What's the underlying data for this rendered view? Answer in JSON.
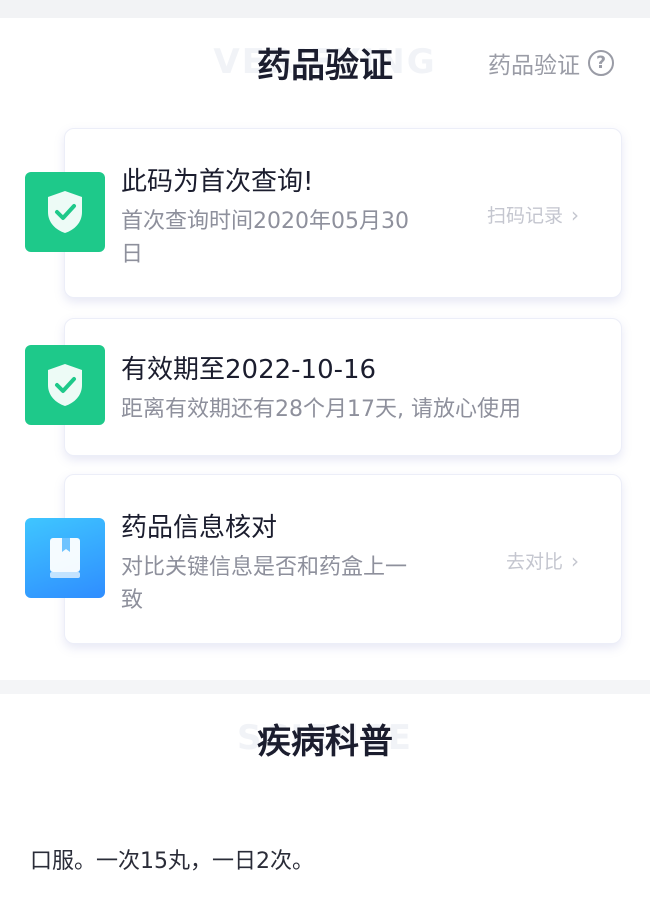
{
  "colors": {
    "accent_green": "#1ec98a",
    "accent_blue": "#2f8dff",
    "title_text": "#1b1d2e",
    "muted_text": "#8e909c"
  },
  "verification_section": {
    "watermark": "VERIFYING",
    "title": "药品验证",
    "help_label": "药品验证",
    "help_icon": "question-circle-icon"
  },
  "cards": [
    {
      "icon": "shield-check-icon",
      "title": "此码为首次查询!",
      "desc_line1": "首次查询时间2020年05月30",
      "desc_line2": "日",
      "link": "扫码记录"
    },
    {
      "icon": "shield-check-icon",
      "title": "有效期至2022-10-16",
      "desc_line1": "距离有效期还有28个月17天, 请放心使用"
    },
    {
      "icon": "book-icon",
      "title": "药品信息核对",
      "desc_line1": "对比关键信息是否和药盒上一",
      "desc_line2": "致",
      "link": "去对比"
    }
  ],
  "science_section": {
    "watermark": "SCIENCE",
    "title": "疾病科普"
  },
  "instruction": "口服。一次15丸，一日2次。"
}
